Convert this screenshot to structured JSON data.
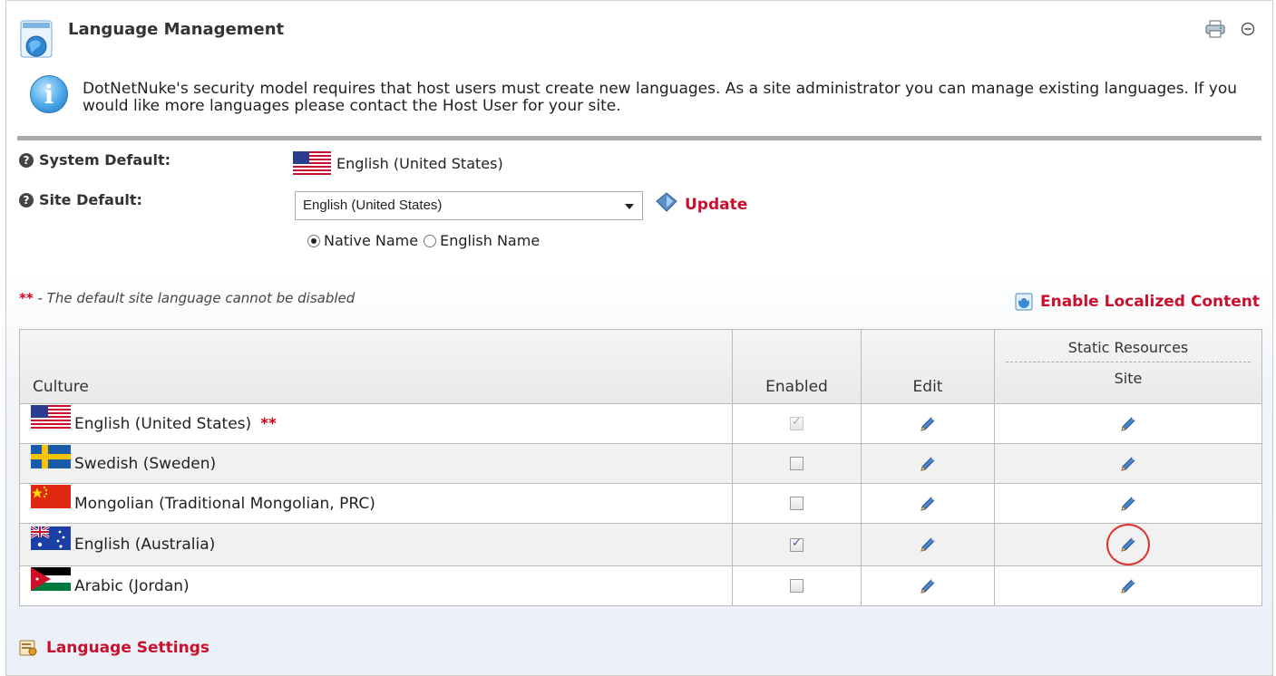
{
  "header": {
    "title": "Language Management",
    "icons": [
      "module-globe-icon",
      "print-icon",
      "minimize-icon"
    ]
  },
  "info": {
    "icon": "info-icon",
    "text": "DotNetNuke's security model requires that host users must create new languages. As a site administrator you can manage existing languages. If you would like more languages please contact the Host User for your site."
  },
  "defaults": {
    "system_default_label": "System Default:",
    "system_default_value": "English (United States)",
    "site_default_label": "Site Default:",
    "site_default_selected": "English (United States)",
    "update_label": "Update",
    "radio_native": "Native Name",
    "radio_english": "English Name",
    "radio_selected": "Native Name"
  },
  "note": {
    "stars": "**",
    "text": " - The default site language cannot be disabled"
  },
  "enable_localized_content": "Enable Localized Content",
  "table": {
    "headers": {
      "culture": "Culture",
      "enabled": "Enabled",
      "edit": "Edit",
      "static_resources": "Static Resources",
      "site": "Site"
    },
    "rows": [
      {
        "flag": "us",
        "culture": "English (United States)",
        "stars": "**",
        "enabled": true,
        "disabled": true
      },
      {
        "flag": "se",
        "culture": "Swedish (Sweden)",
        "stars": "",
        "enabled": false,
        "disabled": false
      },
      {
        "flag": "cn",
        "culture": "Mongolian (Traditional Mongolian, PRC)",
        "stars": "",
        "enabled": false,
        "disabled": false
      },
      {
        "flag": "au",
        "culture": "English (Australia)",
        "stars": "",
        "enabled": true,
        "disabled": false
      },
      {
        "flag": "jo",
        "culture": "Arabic (Jordan)",
        "stars": "",
        "enabled": false,
        "disabled": false
      }
    ]
  },
  "language_settings": "Language Settings",
  "colors": {
    "accent_red": "#c8102e",
    "highlight_circle": "#e03030"
  }
}
